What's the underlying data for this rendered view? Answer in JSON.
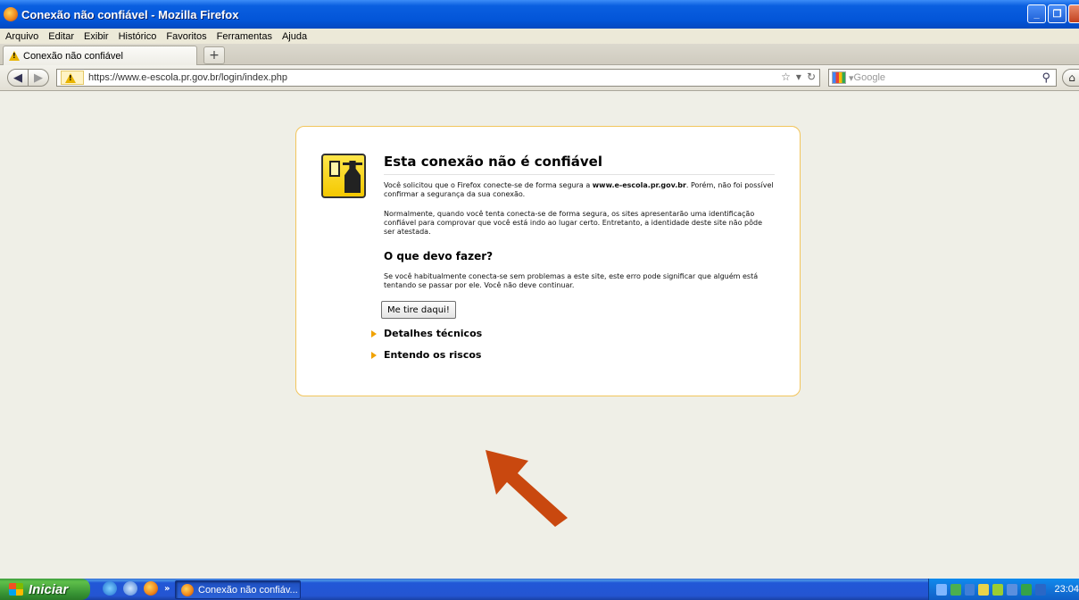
{
  "window": {
    "title": "Conexão não confiável - Mozilla Firefox",
    "min_label": "_",
    "max_label": "❐",
    "close_label": "X"
  },
  "menu": [
    "Arquivo",
    "Editar",
    "Exibir",
    "Histórico",
    "Favoritos",
    "Ferramentas",
    "Ajuda"
  ],
  "tab": {
    "label": "Conexão não confiável",
    "new_tab_label": "+"
  },
  "nav": {
    "url": "https://www.e-escola.pr.gov.br/login/index.php",
    "search_placeholder": "Google"
  },
  "error": {
    "title": "Esta conexão não é confiável",
    "para1_prefix": "Você solicitou que o Firefox conecte-se de forma segura a ",
    "para1_host": "www.e-escola.pr.gov.br",
    "para1_suffix": ". Porém, não foi possível confirmar a segurança da sua conexão.",
    "para2": "Normalmente, quando você tenta conecta-se de forma segura, os sites apresentarão uma identificação confiável para comprovar que você está indo ao lugar certo. Entretanto, a identidade deste site não pôde ser atestada.",
    "heading": "O que devo fazer?",
    "para3": "Se você habitualmente conecta-se sem problemas a este site, este erro pode significar que alguém está tentando se passar por ele. Você não deve continuar.",
    "button": "Me tire daqui!",
    "expander1": "Detalhes técnicos",
    "expander2": "Entendo os riscos"
  },
  "annotation": {
    "arrow_color": "#c9480f"
  },
  "taskbar": {
    "start_label": "Iniciar",
    "quicklaunch_more": "»",
    "task_label": "Conexão não confiáv...",
    "clock": "23:04"
  }
}
